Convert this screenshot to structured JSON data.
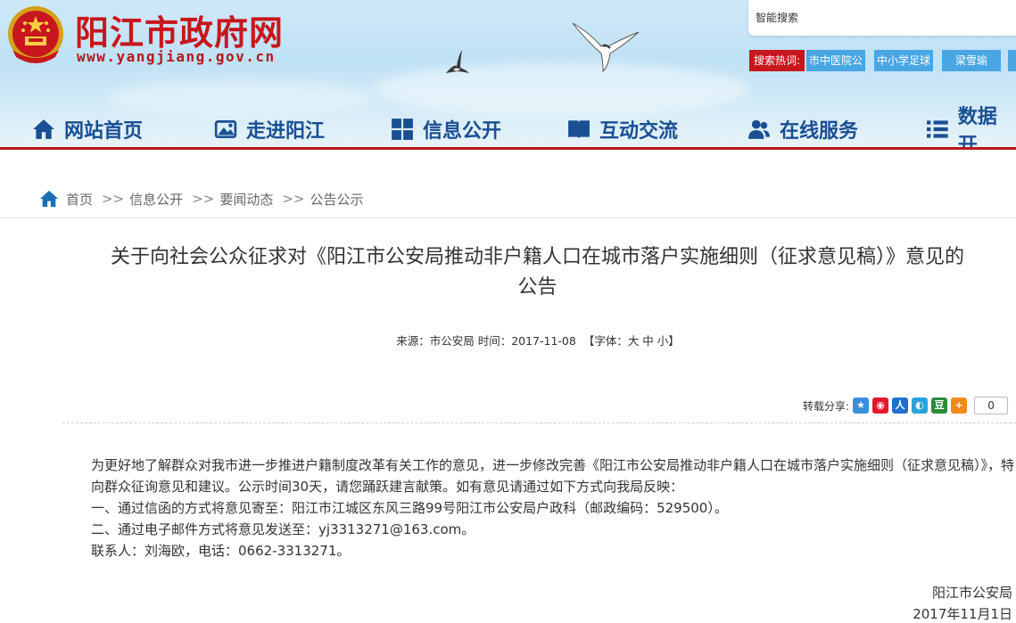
{
  "header": {
    "site_title": "阳江市政府网",
    "site_url": "www.yangjiang.gov.cn",
    "search": {
      "placeholder": "智能搜索"
    },
    "hot_search": {
      "label": "搜索热词:",
      "items": [
        "市中医院公",
        "中小学足球",
        "梁雪瑜"
      ]
    }
  },
  "nav": {
    "items": [
      {
        "label": "网站首页",
        "icon": "home-icon"
      },
      {
        "label": "走进阳江",
        "icon": "picture-icon"
      },
      {
        "label": "信息公开",
        "icon": "grid-icon"
      },
      {
        "label": "互动交流",
        "icon": "book-icon"
      },
      {
        "label": "在线服务",
        "icon": "users-icon"
      },
      {
        "label": "数据开",
        "icon": "list-icon"
      }
    ]
  },
  "breadcrumb": {
    "items": [
      "首页",
      "信息公开",
      "要闻动态",
      "公告公示"
    ],
    "separator": ">>"
  },
  "article": {
    "title_line1": "关于向社会公众征求对《阳江市公安局推动非户籍人口在城市落户实施细则（征求意见稿）》意见的",
    "title_line2": "公告",
    "meta_source": "来源：市公安局 时间：2017-11-08",
    "meta_font": "【字体：大 中 小】",
    "share_label": "转载分享:",
    "share_count": "0",
    "paragraphs": [
      "为更好地了解群众对我市进一步推进户籍制度改革有关工作的意见，进一步修改完善《阳江市公安局推动非户籍人口在城市落户实施细则（征求意见稿）》，特向群众征询意见和建议。公示时间30天，请您踊跃建言献策。如有意见请通过如下方式向我局反映：",
      "一、通过信函的方式将意见寄至：阳江市江城区东风三路99号阳江市公安局户政科（邮政编码：529500）。",
      "二、通过电子邮件方式将意见发送至：yj3313271@163.com。",
      "联系人：刘海欧，电话：0662-3313271。"
    ],
    "signature_org": "阳江市公安局",
    "signature_date": "2017年11月1日"
  },
  "colors": {
    "brand_red": "#c8161d",
    "nav_blue": "#1a4f93",
    "hot_blue": "#4aa6e3"
  }
}
